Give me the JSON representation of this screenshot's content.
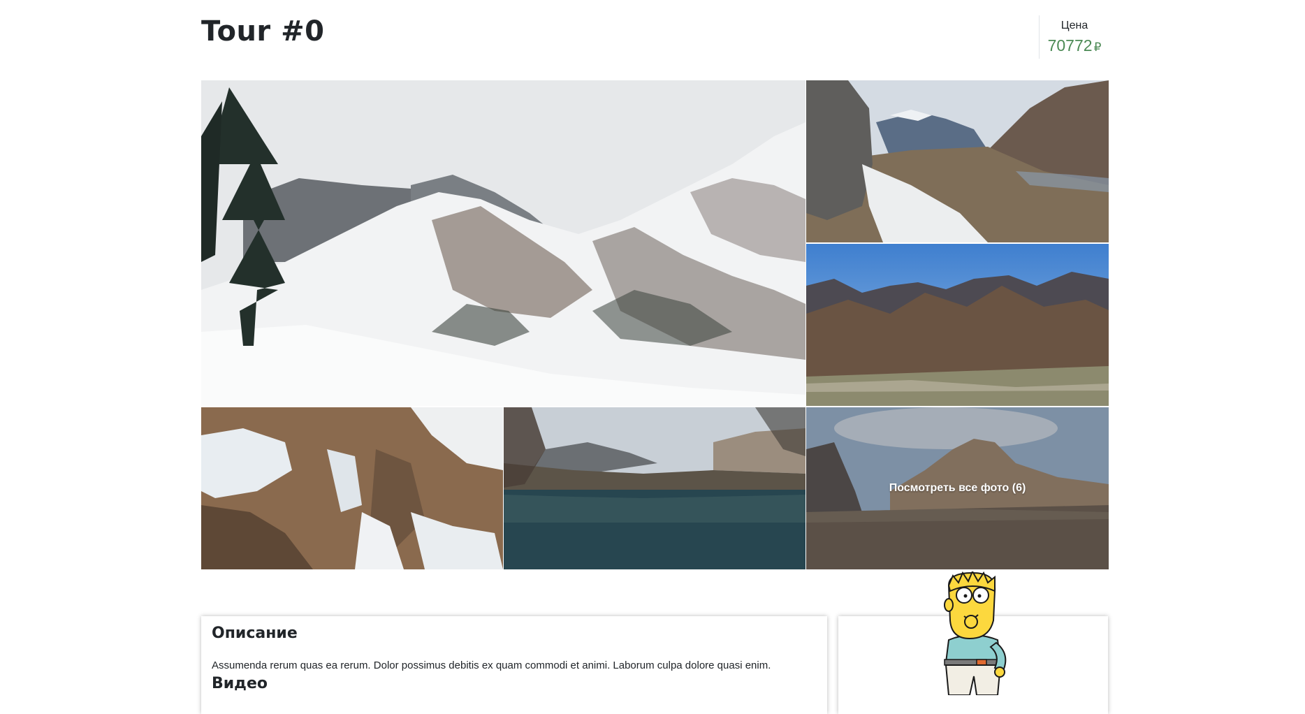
{
  "tour": {
    "title": "Tour #0"
  },
  "price": {
    "label": "Цена",
    "value": "70772",
    "currency": "₽",
    "color": "#4c8a55"
  },
  "gallery": {
    "photos": [
      {
        "name": "snowy-mountain-forest"
      },
      {
        "name": "rocky-valley-snow"
      },
      {
        "name": "sunlit-mountain-ridge"
      },
      {
        "name": "frozen-waterfall-cliff"
      },
      {
        "name": "blue-lake-reflection"
      },
      {
        "name": "rocky-plateau"
      }
    ],
    "view_all_label": "Посмотреть все фото (6)"
  },
  "description": {
    "heading": "Описание",
    "text": "Assumenda rerum quas ea rerum. Dolor possimus debitis ex quam commodi et animi. Laborum culpa dolore quasi enim.",
    "video_heading": "Видео"
  },
  "mascot": {
    "icon": "cartoon-boy-mascot-icon"
  }
}
